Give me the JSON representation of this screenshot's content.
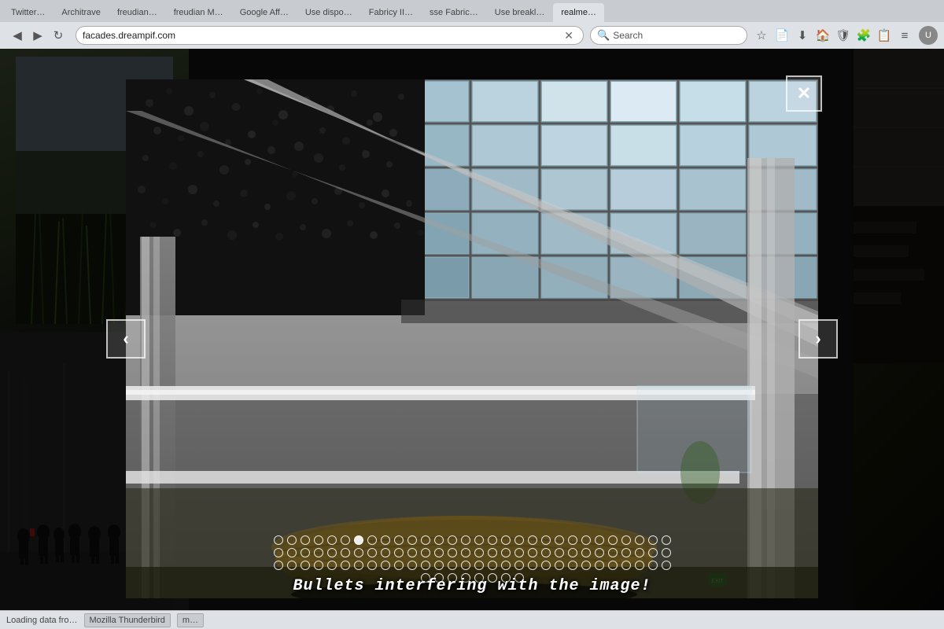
{
  "browser": {
    "url": "facades.dreampif.com",
    "search_placeholder": "Search",
    "tabs": [
      {
        "label": "Twitter…",
        "active": false
      },
      {
        "label": "Architrave",
        "active": false
      },
      {
        "label": "freudian…",
        "active": false
      },
      {
        "label": "freudian M…",
        "active": false
      },
      {
        "label": "Google Aff…",
        "active": false
      },
      {
        "label": "Use dispo…",
        "active": false
      },
      {
        "label": "Fabricy II…",
        "active": false
      },
      {
        "label": "sse Fabric…",
        "active": false
      },
      {
        "label": "Use breakl…",
        "active": false
      },
      {
        "label": "realme…",
        "active": true
      }
    ]
  },
  "lightbox": {
    "close_label": "✕",
    "prev_label": "‹",
    "next_label": "›",
    "warning_text": "Bullets interfering with the image!",
    "total_bullets": {
      "row1": 30,
      "row2": 30,
      "row3": 30,
      "row4": 8,
      "active_index": 6
    }
  },
  "status_bar": {
    "items": [
      {
        "label": "Loading data fro…"
      },
      {
        "label": "Mozilla Thunderbird"
      },
      {
        "label": "m…"
      }
    ]
  }
}
